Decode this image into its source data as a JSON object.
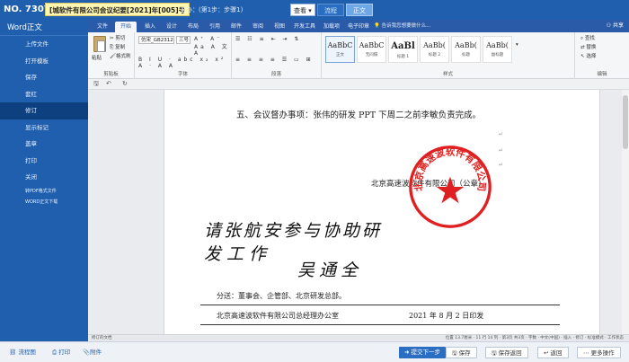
{
  "header": {
    "doc_no": "NO. 73078",
    "doc_title": "[城软件有限公司会议纪要[2021]年[005]号",
    "meta": "主办：(第1步：步骤1)",
    "view_select": "查看",
    "tabs": [
      "流程",
      "正文"
    ]
  },
  "sidebar": {
    "title": "Word正文",
    "items": [
      {
        "label": "上传文件"
      },
      {
        "label": "打开模板"
      },
      {
        "label": "保存"
      },
      {
        "label": "套红"
      },
      {
        "label": "修订",
        "active": true
      },
      {
        "label": "显示标记"
      },
      {
        "label": "盖章"
      },
      {
        "label": "打印"
      },
      {
        "label": "关闭"
      },
      {
        "label": "转PDF格式文件"
      },
      {
        "label": "WORD正文下载"
      }
    ]
  },
  "ribbon": {
    "tabs": [
      "文件",
      "开始",
      "插入",
      "设计",
      "布局",
      "引用",
      "邮件",
      "审阅",
      "视图",
      "开发工具",
      "加载项",
      "电子印章"
    ],
    "active_tab": "开始",
    "search": "告诉我您想要做什么...",
    "share": "共享",
    "clipboard": {
      "paste": "粘贴",
      "cut": "剪切",
      "copy": "复制",
      "format_painter": "格式刷",
      "label": "剪贴板"
    },
    "font": {
      "name": "仿宋_GB2312",
      "size": "三号",
      "row1": "A⁺ A⁻ Aa A 文 A",
      "row2": "B I U · abc x₂ x² A · A A",
      "label": "字体"
    },
    "paragraph": {
      "label": "段落"
    },
    "styles": {
      "items": [
        {
          "preview": "AaBbC",
          "name": "正文"
        },
        {
          "preview": "AaBbC",
          "name": "无间隔"
        },
        {
          "preview": "AaBl",
          "name": "标题 1"
        },
        {
          "preview": "AaBb(",
          "name": "标题 2"
        },
        {
          "preview": "AaBb(",
          "name": "标题"
        },
        {
          "preview": "AaBb(",
          "name": "副标题"
        }
      ],
      "label": "样式"
    },
    "editing": {
      "find": "查找",
      "replace": "替换",
      "select": "选择",
      "label": "编辑"
    }
  },
  "document": {
    "item5": "五、会议督办事项：张伟的研发 PPT 下周二之前李敏负责完成。",
    "signature_company": "北京高速波软件有限公司（公章）",
    "handwriting": [
      "请张航安参与协助研",
      "发工作",
      "吴通全"
    ],
    "cc": "分送：董事会、企管部、北京研发总部。",
    "issuer": "北京高速波软件有限公司总经理办公室",
    "issue_date": "2021 年 8 月 2 日印发",
    "seal_text": "北京高速波软件有限公司"
  },
  "status": {
    "left": "修订的文档",
    "right": "位置 13.7厘米 · 11 行 14 列 · 第3页 共3页 · 字数 · 中文(中国) · 插入 · 修订 · 标准模式 · 工作状态"
  },
  "bottom": {
    "flowchart": "流程图",
    "print": "打印",
    "attachments": "附件",
    "next": "提交下一步",
    "save": "保存",
    "save_return": "保存返回",
    "back": "返回",
    "more": "更多操作"
  },
  "colors": {
    "primary": "#1f5fae",
    "seal_red": "#e02020",
    "active_sidebar": "#0e3f7e"
  }
}
